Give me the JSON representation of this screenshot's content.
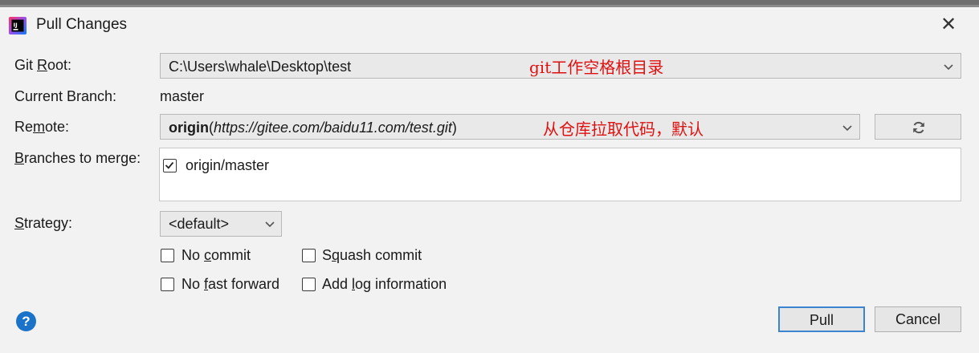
{
  "window": {
    "title": "Pull Changes",
    "close_symbol": "✕"
  },
  "git_root": {
    "label_pre": "Git ",
    "label_mn": "R",
    "label_post": "oot:",
    "value": "C:\\Users\\whale\\Desktop\\test",
    "annotation": "git工作空格根目录"
  },
  "current_branch": {
    "label": "Current Branch:",
    "value": "master"
  },
  "remote": {
    "label_pre": "Re",
    "label_mn": "m",
    "label_post": "ote:",
    "name": "origin",
    "url": "https://gitee.com/baidu11.com/test.git",
    "paren_open": "(",
    "paren_close": ")",
    "annotation": "从仓库拉取代码，默认"
  },
  "branches": {
    "label_mn": "B",
    "label_post": "ranches to merge:",
    "items": [
      {
        "name": "origin/master",
        "checked": true
      }
    ]
  },
  "strategy": {
    "label_mn": "S",
    "label_post": "trategy:",
    "value": "<default>"
  },
  "options": {
    "no_commit": {
      "pre": "No ",
      "mn": "c",
      "post": "ommit",
      "checked": false
    },
    "squash_commit": {
      "pre": "S",
      "mn": "q",
      "post": "uash commit",
      "checked": false
    },
    "no_fast_forward": {
      "pre": "No ",
      "mn": "f",
      "post": "ast forward",
      "checked": false
    },
    "add_log": {
      "pre": "Add ",
      "mn": "l",
      "post": "og information",
      "checked": false
    }
  },
  "buttons": {
    "help": "?",
    "pull": "Pull",
    "cancel": "Cancel"
  },
  "colors": {
    "annotation": "#e01010",
    "help": "#1a73c8",
    "default_button_border": "#3d84d0"
  },
  "icons": {
    "app": "intellij-icon",
    "refresh": "refresh-icon",
    "dropdown": "chevron-down-icon",
    "checkbox": "checkmark-icon"
  }
}
